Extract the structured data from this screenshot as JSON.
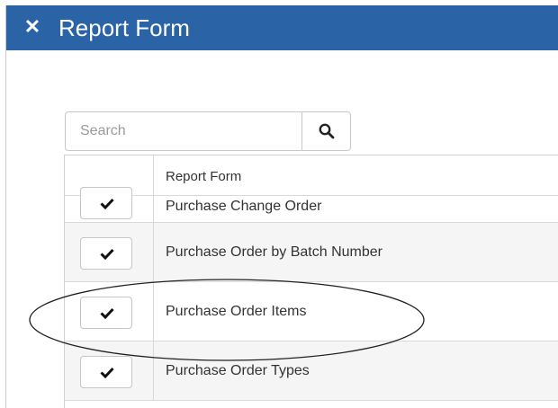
{
  "window": {
    "title": "Report Form",
    "close_glyph": "✕"
  },
  "search": {
    "placeholder": "Search",
    "value": "",
    "icon": "search-icon"
  },
  "table": {
    "header": "Report Form",
    "rows": [
      {
        "label": "Purchase Change Order",
        "selected": true
      },
      {
        "label": "Purchase Order by Batch Number",
        "selected": true
      },
      {
        "label": "Purchase Order Items",
        "selected": true,
        "highlighted": true
      },
      {
        "label": "Purchase Order Types",
        "selected": true
      }
    ]
  },
  "colors": {
    "titlebar": "#2a63a6",
    "row_alt": "#f5f5f5",
    "annotation": "#222222"
  }
}
